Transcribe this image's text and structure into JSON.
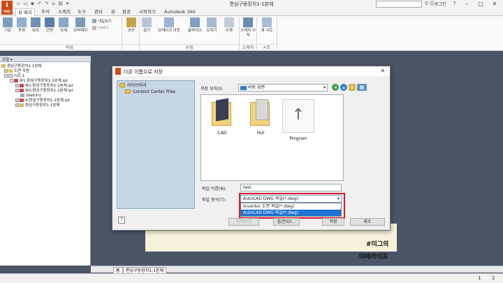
{
  "window": {
    "app_logo": "I",
    "app_logo_sub": "PRO",
    "title": "편심구동장치1-1본체",
    "login": "로그인",
    "min": "–",
    "max": "□",
    "close": "✕"
  },
  "menu": {
    "tabs": [
      {
        "label": "뷰 배치",
        "active": true
      },
      {
        "label": "주석"
      },
      {
        "label": "스케치"
      },
      {
        "label": "도구"
      },
      {
        "label": "관리"
      },
      {
        "label": "뷰"
      },
      {
        "label": "환경"
      },
      {
        "label": "시작하기"
      },
      {
        "label": "Autodesk 360"
      }
    ]
  },
  "ribbon": {
    "create_buttons": [
      "기준",
      "투영",
      "보조",
      "단면",
      "상세",
      "오버레이"
    ],
    "small_buttons": [
      "네일보드",
      "커버더"
    ],
    "draft_label": "초안",
    "modify_buttons": [
      "끊기",
      "브레이크 아웃",
      "슬라이스",
      "오리기"
    ],
    "other_buttons": [
      "수평"
    ],
    "sketch_button": "스케치 시작",
    "sheet_button": "새 시트",
    "groups": [
      "작성",
      "수정",
      "스케치",
      "시트"
    ]
  },
  "browser": {
    "header": "모형 ▾",
    "items": [
      {
        "label": "편심구동장치1-1본체",
        "indent": 0,
        "pm": ""
      },
      {
        "label": "도면 자원",
        "indent": 1,
        "pm": "+"
      },
      {
        "label": "시트:1",
        "indent": 1,
        "pm": "–"
      },
      {
        "label": "뷰1:편심구동장치1-1본체.ipt",
        "indent": 2,
        "pm": "–"
      },
      {
        "label": "뷰2:편심구동장치1-1본체.ipt",
        "indent": 3,
        "pm": "+"
      },
      {
        "label": "뷰3:편심구동장치1-1본체.ipt",
        "indent": 3,
        "pm": "+"
      },
      {
        "label": "Sketch1",
        "indent": 3,
        "pm": ""
      },
      {
        "label": "A:편심구동장치1-1본체.ipt",
        "indent": 3,
        "pm": "+"
      },
      {
        "label": "편심구동장치1-1본체",
        "indent": 2,
        "pm": "+"
      }
    ]
  },
  "doc_tabs": {
    "home": "홈",
    "doc": "편심구동장치1-1본체"
  },
  "status": {
    "page1": "1",
    "page2": "2"
  },
  "watermark": {
    "line1": "#미그의",
    "line2": "야매라이프"
  },
  "dialog": {
    "title": "다른 이름으로 저장",
    "close": "✕",
    "left_items": [
      "라이브러리",
      "Content Center Files"
    ],
    "save_in_label": "저장 위치(I):",
    "save_in_value": "바탕 화면",
    "files": [
      "CAD",
      "HUI",
      "Program"
    ],
    "filename_label": "파일 이름(N):",
    "filename_value": "test",
    "filetype_label": "파일 형식(T):",
    "filetype_value": "AutoCAD DWG 파일(*.dwg)",
    "filetype_options": [
      "Inventor 도면 파일(*.dwg)",
      "AutoCAD DWG 파일(*.dwg)"
    ],
    "help": "?",
    "buttons": [
      "미리보기",
      "옵션(O)...",
      "저장",
      "취소"
    ]
  }
}
